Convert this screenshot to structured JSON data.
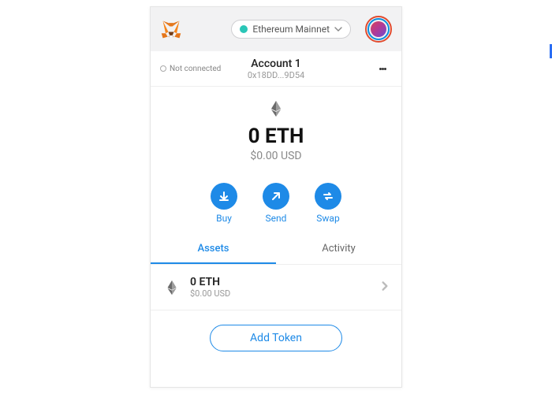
{
  "header": {
    "network_label": "Ethereum Mainnet",
    "network_dot_color": "#2ac6b7"
  },
  "account": {
    "connection_status": "Not connected",
    "name": "Account 1",
    "address_short": "0x18DD...9D54"
  },
  "balance": {
    "amount": "0 ETH",
    "fiat": "$0.00 USD"
  },
  "actions": {
    "buy": "Buy",
    "send": "Send",
    "swap": "Swap"
  },
  "tabs": {
    "assets": "Assets",
    "activity": "Activity",
    "active": "assets"
  },
  "assets": [
    {
      "amount": "0 ETH",
      "fiat": "$0.00 USD"
    }
  ],
  "add_token_label": "Add Token",
  "colors": {
    "primary": "#1e8ae7"
  }
}
